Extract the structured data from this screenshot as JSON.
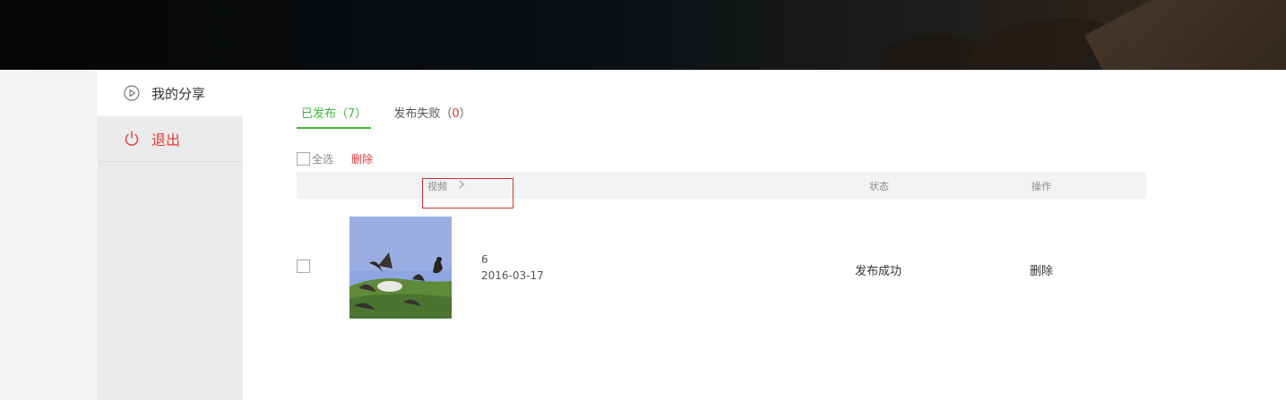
{
  "sidebar": {
    "items": [
      {
        "label": "我的分享",
        "icon": "play-circle-icon"
      },
      {
        "label": "退出",
        "icon": "power-icon"
      }
    ]
  },
  "tabs": {
    "published_label": "已发布（",
    "published_count": "7",
    "published_close": "）",
    "failed_label": "发布失败（",
    "failed_count": "0",
    "failed_close": "）"
  },
  "actions": {
    "select_all": "全选",
    "delete": "删除"
  },
  "table": {
    "headers": {
      "video": "视频",
      "status": "状态",
      "ops": "操作"
    },
    "rows": [
      {
        "title": "6",
        "date": "2016-03-17",
        "status": "发布成功",
        "ops": "删除"
      }
    ]
  },
  "colors": {
    "accent_green": "#3cb934",
    "danger_red": "#e53935",
    "highlight_red": "#d32f2f"
  }
}
